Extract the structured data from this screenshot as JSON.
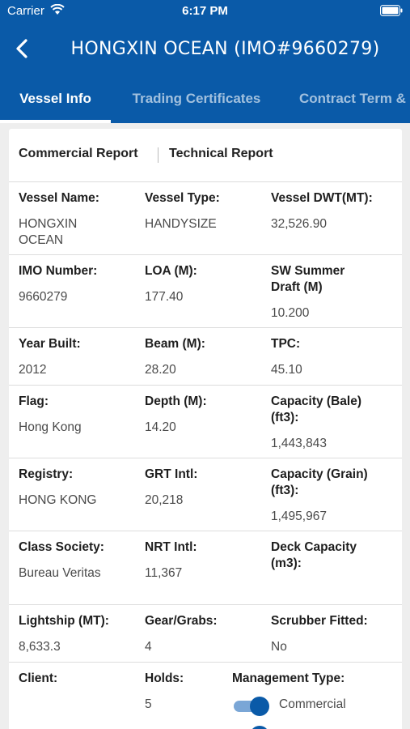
{
  "status_bar": {
    "carrier": "Carrier",
    "time": "6:17 PM"
  },
  "nav": {
    "title": "HONGXIN OCEAN (IMO#9660279)",
    "back_icon": "chevron-left-icon"
  },
  "tabs": [
    {
      "label": "Vessel Info",
      "active": true
    },
    {
      "label": "Trading Certificates",
      "active": false
    },
    {
      "label": "Contract Term & Conditions",
      "active": false
    }
  ],
  "report_tabs": {
    "commercial": "Commercial Report",
    "technical": "Technical Report"
  },
  "rows": [
    [
      {
        "label": "Vessel Name:",
        "value": "HONGXIN\nOCEAN"
      },
      {
        "label": "Vessel Type:",
        "value": "HANDYSIZE"
      },
      {
        "label": "Vessel DWT(MT):",
        "value": "32,526.90"
      }
    ],
    [
      {
        "label": "IMO Number:",
        "value": "9660279"
      },
      {
        "label": "LOA (M):",
        "value": "177.40"
      },
      {
        "label": "SW Summer\nDraft (M)",
        "value": "10.200"
      }
    ],
    [
      {
        "label": "Year Built:",
        "value": "2012"
      },
      {
        "label": "Beam (M):",
        "value": "28.20"
      },
      {
        "label": "TPC:",
        "value": "45.10"
      }
    ],
    [
      {
        "label": "Flag:",
        "value": "Hong Kong"
      },
      {
        "label": "Depth (M):",
        "value": "14.20"
      },
      {
        "label": "Capacity (Bale)\n(ft3):",
        "value": "1,443,843"
      }
    ],
    [
      {
        "label": "Registry:",
        "value": "HONG KONG"
      },
      {
        "label": "GRT Intl:",
        "value": "20,218"
      },
      {
        "label": "Capacity (Grain)\n(ft3):",
        "value": "1,495,967"
      }
    ],
    [
      {
        "label": "Class Society:",
        "value": "Bureau Veritas"
      },
      {
        "label": "NRT Intl:",
        "value": "11,367"
      },
      {
        "label": "Deck Capacity\n(m3):",
        "value": ""
      }
    ],
    [
      {
        "label": "Lightship (MT):",
        "value": "8,633.3"
      },
      {
        "label": "Gear/Grabs:",
        "value": "4"
      },
      {
        "label": "Scrubber Fitted:",
        "value": "No"
      }
    ]
  ],
  "last_row": {
    "client": {
      "label": "Client:",
      "value": ""
    },
    "holds": {
      "label": "Holds:",
      "value": "5"
    },
    "management": {
      "label": "Management Type:",
      "options": [
        {
          "label": "Commercial",
          "on": true
        },
        {
          "label": "",
          "on": true
        }
      ]
    }
  },
  "colors": {
    "primary": "#0a5aa8",
    "toggle_track": "#7aa6d6"
  }
}
